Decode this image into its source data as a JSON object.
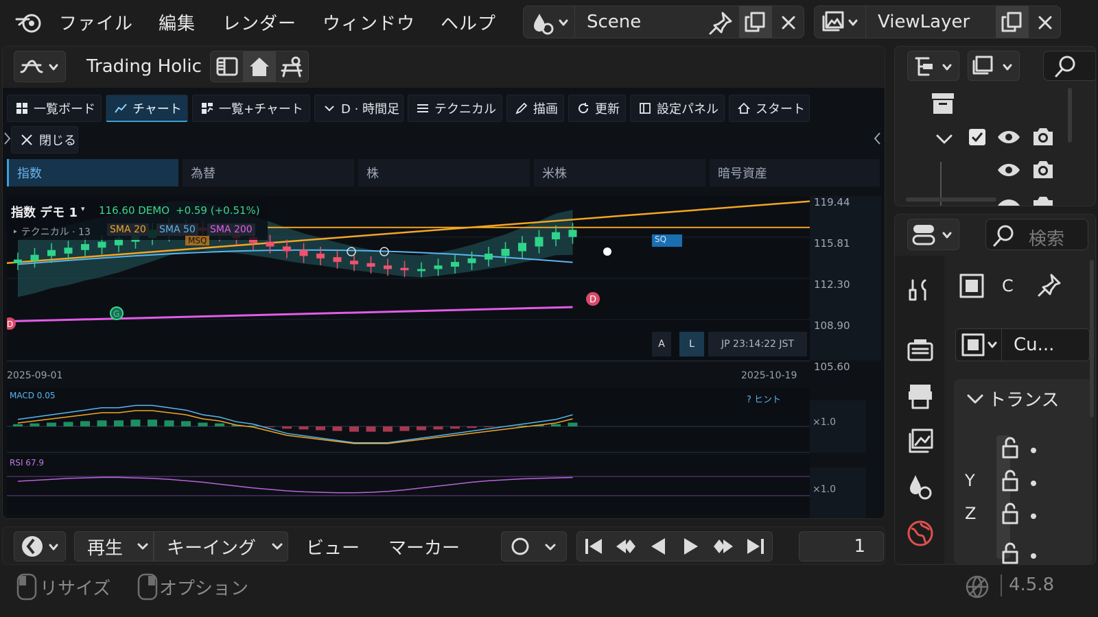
{
  "menu": {
    "items": [
      "ファイル",
      "編集",
      "レンダー",
      "ウィンドウ",
      "ヘルプ"
    ],
    "scene_name": "Scene",
    "view_layer_name": "ViewLayer"
  },
  "editor": {
    "title": "Trading Holic",
    "toolbar": [
      {
        "label": "一覧ボード",
        "icon": "grid-icon"
      },
      {
        "label": "チャート",
        "icon": "chart-line-icon",
        "active": true
      },
      {
        "label": "一覧+チャート",
        "icon": "split-icon"
      },
      {
        "label": "D · 時間足",
        "icon": "chevron-down-icon"
      },
      {
        "label": "テクニカル",
        "icon": "sliders-icon"
      },
      {
        "label": "描画",
        "icon": "pencil-icon"
      },
      {
        "label": "更新",
        "icon": "refresh-icon"
      },
      {
        "label": "設定パネル",
        "icon": "panel-icon"
      },
      {
        "label": "スタート",
        "icon": "home-icon"
      }
    ],
    "close_label": "閉じる",
    "categories": [
      {
        "label": "指数",
        "active": true
      },
      {
        "label": "為替"
      },
      {
        "label": "株"
      },
      {
        "label": "米株"
      },
      {
        "label": "暗号資産"
      }
    ]
  },
  "chart": {
    "symbol_label": "指数 デモ 1",
    "price_line": "116.60 DEMO",
    "change_line": "+0.59  (+0.51%)",
    "technical_label": "‣ テクニカル · 13",
    "sma_labels": [
      "SMA 20",
      "SMA 50",
      "SMA 200"
    ],
    "msq_label": "MSQ",
    "sq_label": "SQ",
    "marker_g": "G",
    "marker_d": "D",
    "mode_a": "A",
    "mode_l": "L",
    "clock": "JP 23:14:22 JST",
    "date_start": "2025-09-01",
    "date_end": "2025-10-19",
    "macd_label": "MACD 0.05",
    "hint_label": "? ヒント",
    "rsi_label": "RSI 67.9",
    "scale_label": "×1.0",
    "colors": {
      "up": "#2fd38a",
      "down": "#f0526e",
      "sma20": "#f5a623",
      "sma50": "#5bb6f0",
      "sma200": "#e45ce8",
      "band": "#1d4a4e"
    }
  },
  "chart_data": {
    "type": "line",
    "y_ticks": [
      "119.44",
      "115.81",
      "112.30",
      "108.90",
      "105.60"
    ],
    "ylim": [
      105.6,
      119.44
    ],
    "x_range": [
      "2025-09-01",
      "2025-10-19"
    ],
    "candles": [
      {
        "o": 113.8,
        "c": 114.1
      },
      {
        "o": 114.0,
        "c": 114.5
      },
      {
        "o": 114.4,
        "c": 114.9
      },
      {
        "o": 114.6,
        "c": 115.1
      },
      {
        "o": 114.9,
        "c": 115.4
      },
      {
        "o": 115.1,
        "c": 115.6
      },
      {
        "o": 115.3,
        "c": 115.9
      },
      {
        "o": 115.6,
        "c": 116.3
      },
      {
        "o": 115.9,
        "c": 116.6
      },
      {
        "o": 116.2,
        "c": 117.0
      },
      {
        "o": 116.5,
        "c": 116.9
      },
      {
        "o": 116.8,
        "c": 116.5
      },
      {
        "o": 116.6,
        "c": 116.2
      },
      {
        "o": 116.3,
        "c": 115.9
      },
      {
        "o": 116.0,
        "c": 115.5
      },
      {
        "o": 115.6,
        "c": 115.2
      },
      {
        "o": 115.2,
        "c": 114.8
      },
      {
        "o": 114.9,
        "c": 114.4
      },
      {
        "o": 114.6,
        "c": 114.2
      },
      {
        "o": 114.3,
        "c": 113.9
      },
      {
        "o": 114.0,
        "c": 113.7
      },
      {
        "o": 113.8,
        "c": 113.5
      },
      {
        "o": 113.6,
        "c": 113.3
      },
      {
        "o": 113.4,
        "c": 113.2
      },
      {
        "o": 113.2,
        "c": 113.3
      },
      {
        "o": 113.3,
        "c": 113.6
      },
      {
        "o": 113.5,
        "c": 113.9
      },
      {
        "o": 113.8,
        "c": 114.2
      },
      {
        "o": 114.1,
        "c": 114.6
      },
      {
        "o": 114.4,
        "c": 115.0
      },
      {
        "o": 114.8,
        "c": 115.5
      },
      {
        "o": 115.2,
        "c": 116.0
      },
      {
        "o": 115.8,
        "c": 116.4
      },
      {
        "o": 116.0,
        "c": 116.6
      }
    ],
    "macd_hist": [
      0.03,
      0.04,
      0.05,
      0.06,
      0.07,
      0.08,
      0.08,
      0.09,
      0.09,
      0.08,
      0.07,
      0.05,
      0.04,
      0.02,
      0.01,
      -0.01,
      -0.03,
      -0.04,
      -0.05,
      -0.06,
      -0.07,
      -0.07,
      -0.07,
      -0.06,
      -0.05,
      -0.04,
      -0.03,
      -0.02,
      -0.01,
      0.0,
      0.01,
      0.02,
      0.03,
      0.05
    ],
    "rsi": [
      60,
      62,
      64,
      66,
      67,
      68,
      68,
      67,
      66,
      64,
      61,
      58,
      54,
      50,
      46,
      43,
      40,
      38,
      37,
      36,
      36,
      37,
      39,
      42,
      46,
      50,
      54,
      58,
      61,
      63,
      65,
      66,
      67,
      67.9
    ]
  },
  "timeline": {
    "play_label": "再生",
    "keying_label": "キーイング",
    "view_label": "ビュー",
    "marker_label": "マーカー",
    "frame": "1"
  },
  "status": {
    "resize_label": "リサイズ",
    "options_label": "オプション",
    "version": "4.5.8"
  },
  "outliner": {},
  "properties": {
    "search_placeholder": "検索",
    "object_name": "C",
    "data_name": "Cu...",
    "section_label": "トランス",
    "axis_y": "Y",
    "axis_z": "Z"
  }
}
